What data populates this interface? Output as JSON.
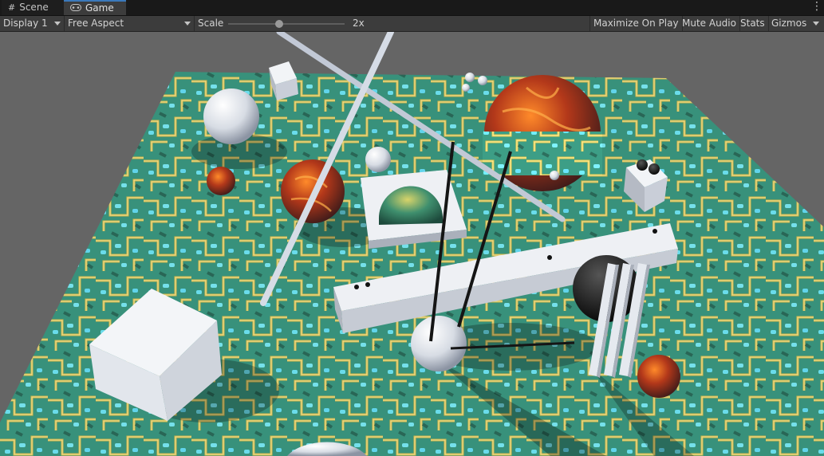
{
  "tabs": [
    {
      "label": "Scene",
      "icon": "grid-icon",
      "active": false
    },
    {
      "label": "Game",
      "icon": "gamepad-icon",
      "active": true
    }
  ],
  "toolbar": {
    "display": "Display 1",
    "aspect": "Free Aspect",
    "scale_label": "Scale",
    "scale_value": "2x",
    "scale_fraction": 0.44,
    "maximize": "Maximize On Play",
    "mute": "Mute Audio",
    "stats": "Stats",
    "gizmos": "Gizmos"
  },
  "colors": {
    "accent": "#3a79bb",
    "panel": "#3c3c3c",
    "ground": "#3fa58a",
    "lava": "#c2441e",
    "primitive": "#e8ebf0"
  }
}
